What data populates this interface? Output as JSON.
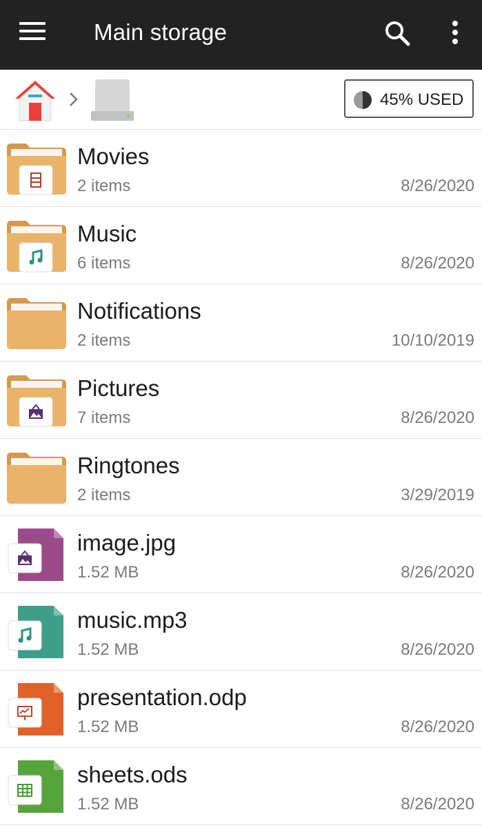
{
  "appbar": {
    "title": "Main storage",
    "bg_color": "#222222",
    "icons": [
      "menu-icon",
      "search-icon",
      "more-vert-icon"
    ]
  },
  "breadcrumb": {
    "icons": [
      "home-icon",
      "chevron-right-icon",
      "drive-icon"
    ],
    "usage_label": "45% USED",
    "usage_fraction": 0.45
  },
  "items": [
    {
      "name": "Movies",
      "sub": "2 items",
      "date": "8/26/2020",
      "kind": "folder",
      "badge": "film-icon"
    },
    {
      "name": "Music",
      "sub": "6 items",
      "date": "8/26/2020",
      "kind": "folder",
      "badge": "music-note-icon"
    },
    {
      "name": "Notifications",
      "sub": "2 items",
      "date": "10/10/2019",
      "kind": "folder",
      "badge": ""
    },
    {
      "name": "Pictures",
      "sub": "7 items",
      "date": "8/26/2020",
      "kind": "folder",
      "badge": "picture-icon"
    },
    {
      "name": "Ringtones",
      "sub": "2 items",
      "date": "3/29/2019",
      "kind": "folder",
      "badge": ""
    },
    {
      "name": "image.jpg",
      "sub": "1.52 MB",
      "date": "8/26/2020",
      "kind": "file",
      "badge": "picture-icon",
      "color": "#9b4a8a"
    },
    {
      "name": "music.mp3",
      "sub": "1.52 MB",
      "date": "8/26/2020",
      "kind": "file",
      "badge": "music-note-icon",
      "color": "#3e9e8a"
    },
    {
      "name": "presentation.odp",
      "sub": "1.52 MB",
      "date": "8/26/2020",
      "kind": "file",
      "badge": "presentation-icon",
      "color": "#e0622a"
    },
    {
      "name": "sheets.ods",
      "sub": "1.52 MB",
      "date": "8/26/2020",
      "kind": "file",
      "badge": "spreadsheet-icon",
      "color": "#56a53c"
    }
  ],
  "colors": {
    "folder": "#e9b46a",
    "folder_dark": "#d39a4e",
    "accent_teal": "#2e8f7d"
  }
}
